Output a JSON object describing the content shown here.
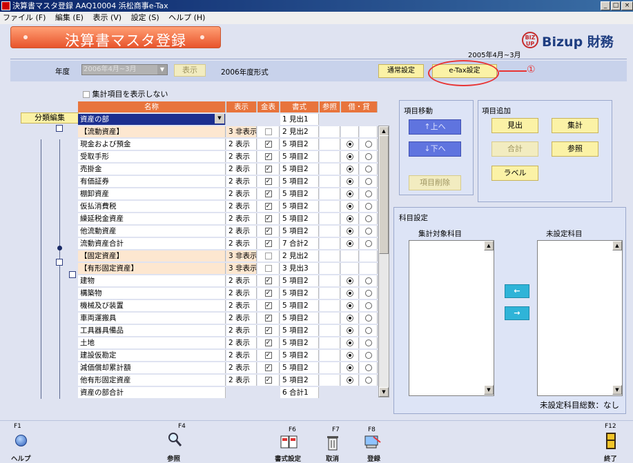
{
  "window": {
    "title": "決算書マスタ登録 AAQ10004 浜松商事e-Tax"
  },
  "menu": [
    "ファイル (F)",
    "編集 (E)",
    "表示 (V)",
    "設定 (S)",
    "ヘルプ (H)"
  ],
  "header": {
    "title": "決算書マスタ登録",
    "period": "2005年4月~3月",
    "logo_mark": "BIZ UP",
    "logo_text": "Bizup 財務"
  },
  "yearbar": {
    "label": "年度",
    "year_value": "2006年4月~3月",
    "show_button": "表示",
    "format_text": "2006年度形式",
    "normal_settings": "通常設定",
    "etax_settings": "e-Tax設定",
    "callout": "①"
  },
  "options": {
    "hide_totals": "集計項目を表示しない"
  },
  "classify_button": "分類編集",
  "grid": {
    "headers": [
      "名称",
      "表示",
      "金表",
      "書式",
      "参照",
      "借・貸"
    ],
    "rows": [
      {
        "name": "資産の部",
        "disp": "",
        "fmt": "1 見出1",
        "chk": null,
        "radio": null,
        "peach": false,
        "selected": true
      },
      {
        "name": "【流動資産】",
        "disp": "3 非表示",
        "fmt": "2 見出2",
        "chk": false,
        "radio": null,
        "peach": true
      },
      {
        "name": "現金および預金",
        "disp": "2 表示",
        "fmt": "5 項目2",
        "chk": true,
        "radio": "debit"
      },
      {
        "name": "受取手形",
        "disp": "2 表示",
        "fmt": "5 項目2",
        "chk": true,
        "radio": "debit"
      },
      {
        "name": "売掛金",
        "disp": "2 表示",
        "fmt": "5 項目2",
        "chk": true,
        "radio": "debit"
      },
      {
        "name": "有価証券",
        "disp": "2 表示",
        "fmt": "5 項目2",
        "chk": true,
        "radio": "debit"
      },
      {
        "name": "棚卸資産",
        "disp": "2 表示",
        "fmt": "5 項目2",
        "chk": true,
        "radio": "debit"
      },
      {
        "name": "仮払消費税",
        "disp": "2 表示",
        "fmt": "5 項目2",
        "chk": true,
        "radio": "debit"
      },
      {
        "name": "繰延税金資産",
        "disp": "2 表示",
        "fmt": "5 項目2",
        "chk": true,
        "radio": "debit"
      },
      {
        "name": "他流動資産",
        "disp": "2 表示",
        "fmt": "5 項目2",
        "chk": true,
        "radio": "debit"
      },
      {
        "name": "流動資産合計",
        "disp": "2 表示",
        "fmt": "7 合計2",
        "chk": true,
        "radio": "debit"
      },
      {
        "name": "【固定資産】",
        "disp": "3 非表示",
        "fmt": "2 見出2",
        "chk": false,
        "radio": null,
        "peach": true
      },
      {
        "name": "【有形固定資産】",
        "disp": "3 非表示",
        "fmt": "3 見出3",
        "chk": false,
        "radio": null,
        "peach": true
      },
      {
        "name": "建物",
        "disp": "2 表示",
        "fmt": "5 項目2",
        "chk": true,
        "radio": "debit"
      },
      {
        "name": "構築物",
        "disp": "2 表示",
        "fmt": "5 項目2",
        "chk": true,
        "radio": "debit"
      },
      {
        "name": "機械及び装置",
        "disp": "2 表示",
        "fmt": "5 項目2",
        "chk": true,
        "radio": "debit"
      },
      {
        "name": "車両運搬具",
        "disp": "2 表示",
        "fmt": "5 項目2",
        "chk": true,
        "radio": "debit"
      },
      {
        "name": "工具器具備品",
        "disp": "2 表示",
        "fmt": "5 項目2",
        "chk": true,
        "radio": "debit"
      },
      {
        "name": "土地",
        "disp": "2 表示",
        "fmt": "5 項目2",
        "chk": true,
        "radio": "debit"
      },
      {
        "name": "建設仮勘定",
        "disp": "2 表示",
        "fmt": "5 項目2",
        "chk": true,
        "radio": "debit"
      },
      {
        "name": "減価償却累計額",
        "disp": "2 表示",
        "fmt": "5 項目2",
        "chk": true,
        "radio": "debit"
      },
      {
        "name": "他有形固定資産",
        "disp": "2 表示",
        "fmt": "5 項目2",
        "chk": true,
        "radio": "debit"
      },
      {
        "name": "資産の部合計",
        "disp": "",
        "fmt": "6 合計1",
        "chk": null,
        "radio": null,
        "peach": false
      }
    ]
  },
  "move_panel": {
    "title": "項目移動",
    "up": "↑上へ",
    "down": "↓下へ",
    "delete": "項目削除"
  },
  "add_panel": {
    "title": "項目追加",
    "heading": "見出",
    "total": "集計",
    "subtotal": "合計",
    "reference": "参照",
    "label": "ラベル"
  },
  "account_panel": {
    "title": "科目設定",
    "target_list": "集計対象科目",
    "unset_list": "未設定科目",
    "left_arrow": "←",
    "right_arrow": "→",
    "unset_total": "未設定科目総数：なし"
  },
  "fkeys": [
    {
      "key": "F1",
      "label": "ヘルプ"
    },
    {
      "key": "F4",
      "label": "参照"
    },
    {
      "key": "F6",
      "label": "書式設定"
    },
    {
      "key": "F7",
      "label": "取消"
    },
    {
      "key": "F8",
      "label": "登録"
    },
    {
      "key": "F12",
      "label": "終了"
    }
  ],
  "colors": {
    "accent": "#e8743c",
    "callout": "#e83434",
    "brand": "#1e3d80"
  }
}
